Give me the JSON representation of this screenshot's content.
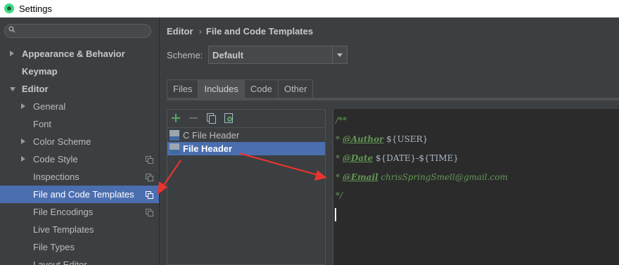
{
  "window": {
    "title": "Settings"
  },
  "sidebar": {
    "search": {
      "placeholder": ""
    },
    "items": [
      {
        "label": "Appearance & Behavior",
        "level": 0,
        "arrow": "right",
        "bold": true
      },
      {
        "label": "Keymap",
        "level": 0,
        "arrow": "",
        "bold": true
      },
      {
        "label": "Editor",
        "level": 0,
        "arrow": "down",
        "bold": true
      },
      {
        "label": "General",
        "level": 1,
        "arrow": "right"
      },
      {
        "label": "Font",
        "level": 1,
        "arrow": ""
      },
      {
        "label": "Color Scheme",
        "level": 1,
        "arrow": "right"
      },
      {
        "label": "Code Style",
        "level": 1,
        "arrow": "right",
        "copy": true
      },
      {
        "label": "Inspections",
        "level": 1,
        "arrow": "",
        "copy": true
      },
      {
        "label": "File and Code Templates",
        "level": 1,
        "arrow": "",
        "copy": true,
        "selected": true
      },
      {
        "label": "File Encodings",
        "level": 1,
        "arrow": "",
        "copy": true
      },
      {
        "label": "Live Templates",
        "level": 1,
        "arrow": ""
      },
      {
        "label": "File Types",
        "level": 1,
        "arrow": ""
      },
      {
        "label": "Layout Editor",
        "level": 1,
        "arrow": ""
      }
    ]
  },
  "breadcrumb": {
    "parent": "Editor",
    "separator": "›",
    "current": "File and Code Templates"
  },
  "scheme": {
    "label": "Scheme:",
    "value": "Default"
  },
  "tabs": [
    {
      "label": "Files",
      "active": false
    },
    {
      "label": "Includes",
      "active": true
    },
    {
      "label": "Code",
      "active": false
    },
    {
      "label": "Other",
      "active": false
    }
  ],
  "toolbar": {
    "icons": [
      "plus-icon",
      "minus-icon",
      "duplicate-icon",
      "reset-icon"
    ]
  },
  "files": [
    {
      "label": "C File Header",
      "selected": false
    },
    {
      "label": "File Header",
      "selected": true
    }
  ],
  "editor": {
    "line1": "/**",
    "line2_star": "* ",
    "line2_tag": "@Author",
    "line2_var": "${USER}",
    "line3_star": "* ",
    "line3_tag": "@Date",
    "line3_var": "${DATE}-${TIME}",
    "line4_star": "* ",
    "line4_tag": "@Email",
    "line4_text": "chrisSpringSmell@gmail.com",
    "line5": "*/"
  },
  "colors": {
    "accent": "#4b6eaf",
    "annotation": "#e8342e",
    "comment": "#629755"
  }
}
